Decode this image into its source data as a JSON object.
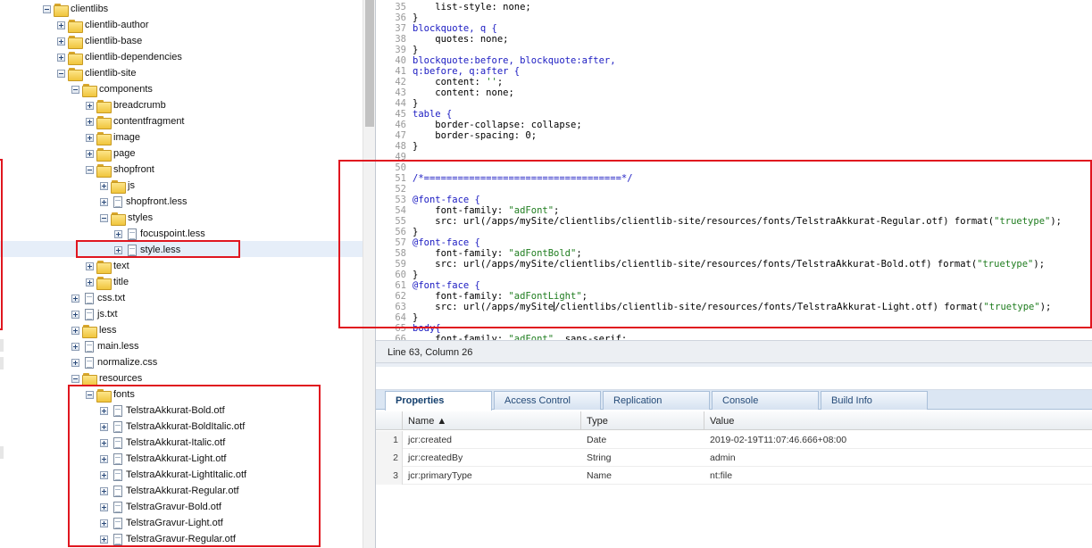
{
  "tree": [
    {
      "label": "clientlibs",
      "depth": 2,
      "toggle": "minus",
      "icon": "folder",
      "top": 0
    },
    {
      "label": "clientlib-author",
      "depth": 3,
      "toggle": "plus",
      "icon": "folder"
    },
    {
      "label": "clientlib-base",
      "depth": 3,
      "toggle": "plus",
      "icon": "folder"
    },
    {
      "label": "clientlib-dependencies",
      "depth": 3,
      "toggle": "plus",
      "icon": "folder"
    },
    {
      "label": "clientlib-site",
      "depth": 3,
      "toggle": "minus",
      "icon": "folder"
    },
    {
      "label": "components",
      "depth": 4,
      "toggle": "minus",
      "icon": "folder"
    },
    {
      "label": "breadcrumb",
      "depth": 5,
      "toggle": "plus",
      "icon": "folder"
    },
    {
      "label": "contentfragment",
      "depth": 5,
      "toggle": "plus",
      "icon": "folder"
    },
    {
      "label": "image",
      "depth": 5,
      "toggle": "plus",
      "icon": "folder"
    },
    {
      "label": "page",
      "depth": 5,
      "toggle": "plus",
      "icon": "folder"
    },
    {
      "label": "shopfront",
      "depth": 5,
      "toggle": "minus",
      "icon": "folder"
    },
    {
      "label": "js",
      "depth": 6,
      "toggle": "plus",
      "icon": "folder"
    },
    {
      "label": "shopfront.less",
      "depth": 6,
      "toggle": "plus",
      "icon": "file"
    },
    {
      "label": "styles",
      "depth": 6,
      "toggle": "minus",
      "icon": "folder"
    },
    {
      "label": "focuspoint.less",
      "depth": 7,
      "toggle": "plus",
      "icon": "file"
    },
    {
      "label": "style.less",
      "depth": 7,
      "toggle": "plus",
      "icon": "file",
      "selected": true
    },
    {
      "label": "text",
      "depth": 5,
      "toggle": "plus",
      "icon": "folder"
    },
    {
      "label": "title",
      "depth": 5,
      "toggle": "plus",
      "icon": "folder"
    },
    {
      "label": "css.txt",
      "depth": 4,
      "toggle": "plus",
      "icon": "file"
    },
    {
      "label": "js.txt",
      "depth": 4,
      "toggle": "plus",
      "icon": "file"
    },
    {
      "label": "less",
      "depth": 4,
      "toggle": "plus",
      "icon": "folder"
    },
    {
      "label": "main.less",
      "depth": 4,
      "toggle": "plus",
      "icon": "file"
    },
    {
      "label": "normalize.css",
      "depth": 4,
      "toggle": "plus",
      "icon": "file"
    },
    {
      "label": "resources",
      "depth": 4,
      "toggle": "minus",
      "icon": "folder"
    },
    {
      "label": "fonts",
      "depth": 5,
      "toggle": "minus",
      "icon": "folder"
    },
    {
      "label": "TelstraAkkurat-Bold.otf",
      "depth": 6,
      "toggle": "plus",
      "icon": "file"
    },
    {
      "label": "TelstraAkkurat-BoldItalic.otf",
      "depth": 6,
      "toggle": "plus",
      "icon": "file"
    },
    {
      "label": "TelstraAkkurat-Italic.otf",
      "depth": 6,
      "toggle": "plus",
      "icon": "file"
    },
    {
      "label": "TelstraAkkurat-Light.otf",
      "depth": 6,
      "toggle": "plus",
      "icon": "file"
    },
    {
      "label": "TelstraAkkurat-LightItalic.otf",
      "depth": 6,
      "toggle": "plus",
      "icon": "file"
    },
    {
      "label": "TelstraAkkurat-Regular.otf",
      "depth": 6,
      "toggle": "plus",
      "icon": "file"
    },
    {
      "label": "TelstraGravur-Bold.otf",
      "depth": 6,
      "toggle": "plus",
      "icon": "file"
    },
    {
      "label": "TelstraGravur-Light.otf",
      "depth": 6,
      "toggle": "plus",
      "icon": "file"
    },
    {
      "label": "TelstraGravur-Regular.otf",
      "depth": 6,
      "toggle": "plus",
      "icon": "file"
    }
  ],
  "editor": {
    "first_line": 35,
    "lines": [
      [
        {
          "t": "    list-style: none;"
        }
      ],
      [
        {
          "t": "}"
        }
      ],
      [
        {
          "t": "blockquote, q {",
          "c": "kw"
        }
      ],
      [
        {
          "t": "    quotes: none;"
        }
      ],
      [
        {
          "t": "}"
        }
      ],
      [
        {
          "t": "blockquote:before, blockquote:after,",
          "c": "kw"
        }
      ],
      [
        {
          "t": "q:before, q:after {",
          "c": "kw"
        }
      ],
      [
        {
          "t": "    content: "
        },
        {
          "t": "''",
          "c": "st"
        },
        {
          "t": ";"
        }
      ],
      [
        {
          "t": "    content: none;"
        }
      ],
      [
        {
          "t": "}"
        }
      ],
      [
        {
          "t": "table {",
          "c": "kw"
        }
      ],
      [
        {
          "t": "    border-collapse: collapse;"
        }
      ],
      [
        {
          "t": "    border-spacing: 0;"
        }
      ],
      [
        {
          "t": "}"
        }
      ],
      [
        {
          "t": ""
        }
      ],
      [
        {
          "t": ""
        }
      ],
      [
        {
          "t": "/*===================================*/",
          "c": "cm"
        }
      ],
      [
        {
          "t": ""
        }
      ],
      [
        {
          "t": "@font-face {",
          "c": "kw"
        }
      ],
      [
        {
          "t": "    font-family: "
        },
        {
          "t": "\"adFont\"",
          "c": "st"
        },
        {
          "t": ";"
        }
      ],
      [
        {
          "t": "    src: url(/apps/mySite/clientlibs/clientlib-site/resources/fonts/TelstraAkkurat-Regular.otf) format("
        },
        {
          "t": "\"truetype\"",
          "c": "st"
        },
        {
          "t": ");"
        }
      ],
      [
        {
          "t": "}"
        }
      ],
      [
        {
          "t": "@font-face {",
          "c": "kw"
        }
      ],
      [
        {
          "t": "    font-family: "
        },
        {
          "t": "\"adFontBold\"",
          "c": "st"
        },
        {
          "t": ";"
        }
      ],
      [
        {
          "t": "    src: url(/apps/mySite/clientlibs/clientlib-site/resources/fonts/TelstraAkkurat-Bold.otf) format("
        },
        {
          "t": "\"truetype\"",
          "c": "st"
        },
        {
          "t": ");"
        }
      ],
      [
        {
          "t": "}"
        }
      ],
      [
        {
          "t": "@font-face {",
          "c": "kw"
        }
      ],
      [
        {
          "t": "    font-family: "
        },
        {
          "t": "\"adFontLight\"",
          "c": "st"
        },
        {
          "t": ";"
        }
      ],
      [
        {
          "t": "    src: url(/apps/mySite"
        },
        {
          "t": "",
          "c": "cursor"
        },
        {
          "t": "/clientlibs/clientlib-site/resources/fonts/TelstraAkkurat-Light.otf) format("
        },
        {
          "t": "\"truetype\"",
          "c": "st"
        },
        {
          "t": ");"
        }
      ],
      [
        {
          "t": "}"
        }
      ],
      [
        {
          "t": "body{",
          "c": "kw"
        }
      ],
      [
        {
          "t": "    font-family: "
        },
        {
          "t": "\"adFont\"",
          "c": "st"
        },
        {
          "t": ", sans-serif;"
        }
      ]
    ]
  },
  "status": {
    "text": "Line 63, Column 26"
  },
  "tabs": [
    {
      "label": "Properties",
      "active": true
    },
    {
      "label": "Access Control"
    },
    {
      "label": "Replication"
    },
    {
      "label": "Console"
    },
    {
      "label": "Build Info"
    }
  ],
  "grid": {
    "headers": {
      "name": "Name ▲",
      "type": "Type",
      "value": "Value"
    },
    "rows": [
      {
        "n": "1",
        "name": "jcr:created",
        "type": "Date",
        "value": "2019-02-19T11:07:46.666+08:00"
      },
      {
        "n": "2",
        "name": "jcr:createdBy",
        "type": "String",
        "value": "admin"
      },
      {
        "n": "3",
        "name": "jcr:primaryType",
        "type": "Name",
        "value": "nt:file"
      }
    ]
  },
  "colors": {
    "annotation": "#e0161f",
    "keyword": "#1b1bc2",
    "string": "#1e7c1e"
  }
}
